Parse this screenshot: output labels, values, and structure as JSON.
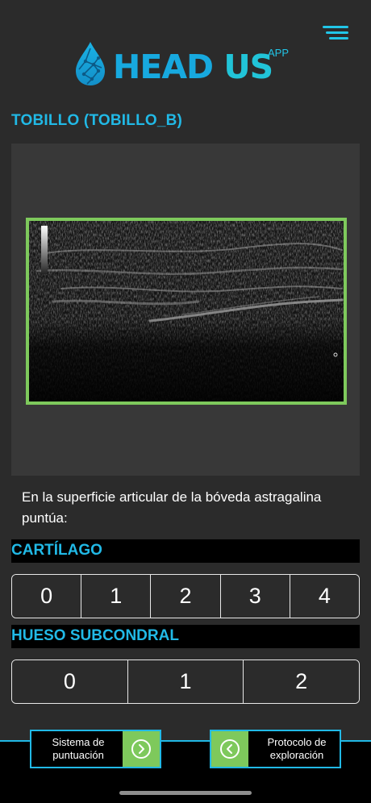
{
  "app": {
    "logo_main": "HEAD US",
    "logo_head": "HEAD",
    "logo_us": "US",
    "logo_sup": "APP"
  },
  "menu": {
    "icon": "hamburger-menu-icon"
  },
  "section": {
    "title": "TOBILLO (TOBILLO_B)"
  },
  "image": {
    "frame_color": "#7ec95c"
  },
  "question": {
    "text": "En la superficie articular de la bóveda astragalina puntúa:"
  },
  "categories": [
    {
      "title": "CARTÍLAGO",
      "scores": [
        "0",
        "1",
        "2",
        "3",
        "4"
      ]
    },
    {
      "title": "HUESO SUBCONDRAL",
      "scores": [
        "0",
        "1",
        "2"
      ]
    }
  ],
  "nav": {
    "left_label": "Sistema de puntuación",
    "left_icon": "chevron-right-circle-icon",
    "right_label": "Protocolo de exploración",
    "right_icon": "chevron-left-circle-icon"
  },
  "colors": {
    "accent": "#21b9e6",
    "green": "#7ec95c",
    "background": "#2b2b2b"
  }
}
